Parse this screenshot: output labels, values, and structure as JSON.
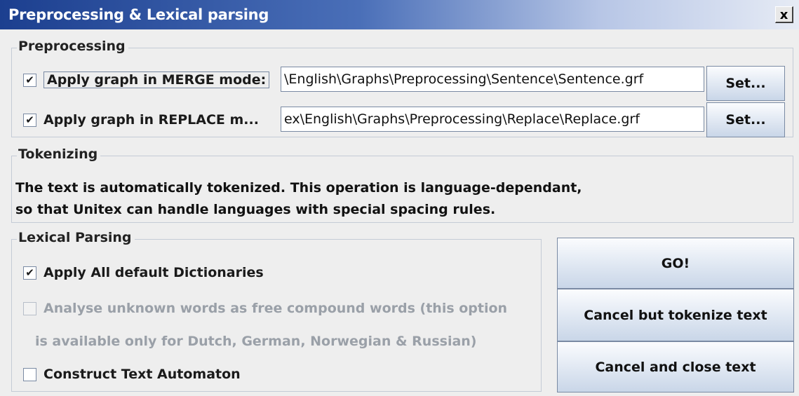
{
  "window": {
    "title": "Preprocessing & Lexical parsing",
    "close_label": "x"
  },
  "preprocessing": {
    "legend": "Preprocessing",
    "merge": {
      "checked": true,
      "label": "Apply graph in MERGE mode:",
      "path": "\\English\\Graphs\\Preprocessing\\Sentence\\Sentence.grf",
      "set_label": "Set..."
    },
    "replace": {
      "checked": true,
      "label": "Apply graph in REPLACE m...",
      "path": "ex\\English\\Graphs\\Preprocessing\\Replace\\Replace.grf",
      "set_label": "Set..."
    }
  },
  "tokenizing": {
    "legend": "Tokenizing",
    "line1": "The text is automatically tokenized. This operation is language-dependant,",
    "line2": "so that Unitex can handle languages with special spacing rules."
  },
  "lexical": {
    "legend": "Lexical Parsing",
    "apply_all": {
      "checked": true,
      "label": "Apply All default Dictionaries"
    },
    "analyse": {
      "checked": false,
      "enabled": false,
      "label": "Analyse unknown words as free compound words (this option",
      "label_cont": "is available only for Dutch, German, Norwegian & Russian)"
    },
    "automaton": {
      "checked": false,
      "label": "Construct Text Automaton"
    }
  },
  "actions": {
    "go_label": "GO!",
    "cancel_tokenize_label": "Cancel but tokenize text",
    "cancel_close_label": "Cancel and close text"
  },
  "glyphs": {
    "check": "✔"
  },
  "colors": {
    "title_start": "#1c3f8f",
    "title_end": "#e6ebf5",
    "disabled_text": "#9aa0a8"
  }
}
